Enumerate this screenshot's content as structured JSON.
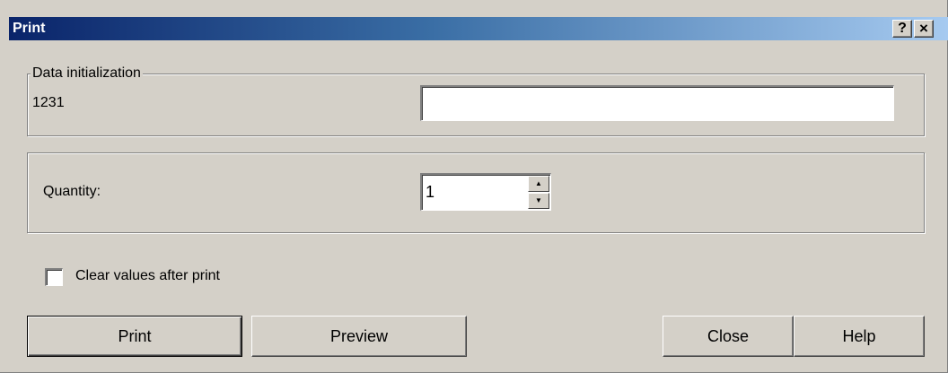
{
  "window": {
    "title": "Print",
    "help_label": "?",
    "close_label": "×"
  },
  "data_initialization": {
    "legend": "Data initialization",
    "field_label": "1231",
    "field_value": ""
  },
  "quantity": {
    "label": "Quantity:",
    "value": "1",
    "up_glyph": "▲",
    "down_glyph": "▼"
  },
  "options": {
    "clear_values_label": "Clear values after print",
    "clear_values_checked": false
  },
  "buttons": {
    "print": "Print",
    "preview": "Preview",
    "close": "Close",
    "help": "Help"
  }
}
